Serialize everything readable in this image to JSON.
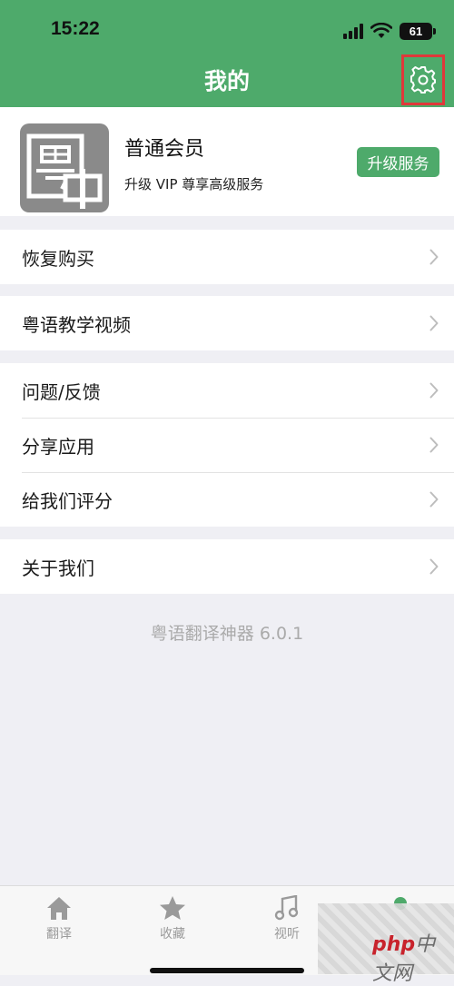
{
  "status_bar": {
    "time": "15:22",
    "battery": "61"
  },
  "header": {
    "title": "我的",
    "settings_icon": "gear-icon"
  },
  "profile": {
    "avatar_icon": "yue-zhong-logo",
    "avatar_logo_text": "粤中",
    "member_name": "普通会员",
    "member_desc": "升级 VIP 尊享高级服务",
    "upgrade_label": "升级服务"
  },
  "menu_groups": [
    {
      "items": [
        {
          "label": "恢复购买"
        }
      ]
    },
    {
      "items": [
        {
          "label": "粤语教学视频"
        }
      ]
    },
    {
      "items": [
        {
          "label": "问题/反馈"
        },
        {
          "label": "分享应用"
        },
        {
          "label": "给我们评分"
        }
      ]
    },
    {
      "items": [
        {
          "label": "关于我们"
        }
      ]
    }
  ],
  "version_text": "粤语翻译神器 6.0.1",
  "tabbar": {
    "tabs": [
      {
        "label": "翻译",
        "icon": "home-icon"
      },
      {
        "label": "收藏",
        "icon": "star-icon"
      },
      {
        "label": "视听",
        "icon": "music-note-icon"
      },
      {
        "label": "",
        "icon": "profile-dot-icon",
        "active": true
      }
    ]
  },
  "watermark": {
    "brand": "php",
    "suffix": "中文网"
  },
  "colors": {
    "accent": "#4eaa6b",
    "highlight_box": "#e0383a",
    "background": "#efeff4"
  }
}
